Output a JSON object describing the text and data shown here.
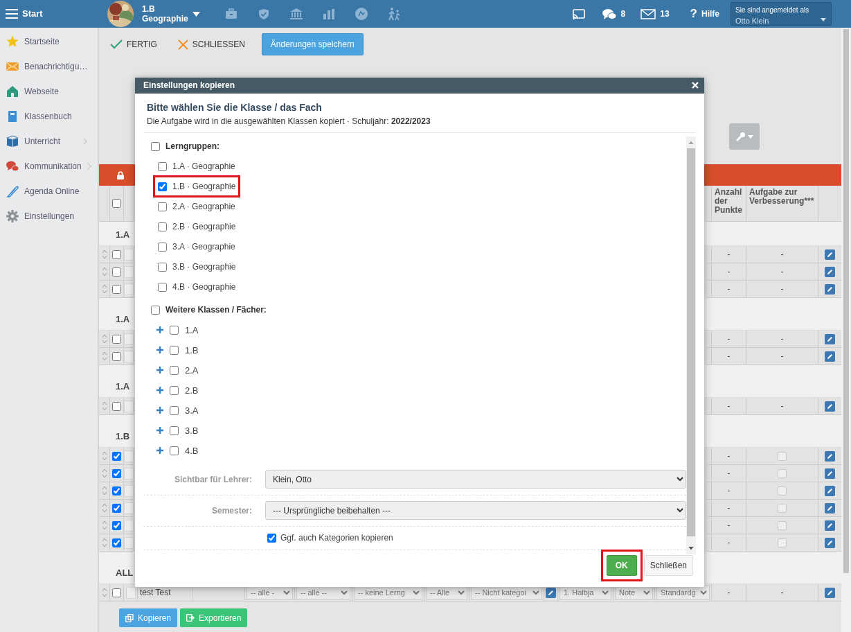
{
  "header": {
    "menu_label": "Start",
    "class_name": "1.B",
    "subject": "Geographie",
    "counters": [
      {
        "kind": "chat",
        "count": "8"
      },
      {
        "kind": "mail",
        "count": "13"
      }
    ],
    "help": {
      "icon": "?",
      "label": "Hilfe"
    },
    "login": {
      "label": "Sie sind angemeldet als",
      "user": "Otto Klein"
    }
  },
  "sidebar": {
    "items": [
      {
        "kind": "star",
        "label": "Startseite",
        "has_submenu": false
      },
      {
        "kind": "mail",
        "label": "Benachrichtigu…",
        "has_submenu": false
      },
      {
        "kind": "home",
        "label": "Webseite",
        "has_submenu": false
      },
      {
        "kind": "notebook",
        "label": "Klassenbuch",
        "has_submenu": false
      },
      {
        "kind": "book",
        "label": "Unterricht",
        "has_submenu": true
      },
      {
        "kind": "chat",
        "label": "Kommunikation",
        "has_submenu": true
      },
      {
        "kind": "pen",
        "label": "Agenda Online",
        "has_submenu": false
      },
      {
        "kind": "gear",
        "label": "Einstellungen",
        "has_submenu": false
      }
    ]
  },
  "toolbar": [
    {
      "kind": "check",
      "label": "FERTIG"
    },
    {
      "kind": "cross",
      "label": "SCHLIESSEN"
    },
    {
      "kind": "primary",
      "label": "Änderungen speichern"
    }
  ],
  "table": {
    "header_checked": false,
    "columns": [
      {
        "label": "Anzahl der Punkte"
      },
      {
        "label": "Aufgabe zur Verbesserung***"
      }
    ],
    "groups": [
      {
        "title": "1.A",
        "rows": [
          {
            "kind": "text",
            "checked": false,
            "points": "-",
            "correction": "-"
          },
          {
            "kind": "text",
            "checked": false,
            "points": "-",
            "correction": "-"
          },
          {
            "kind": "text",
            "checked": false,
            "points": "-",
            "correction": "-"
          }
        ]
      },
      {
        "title": "1.A",
        "rows": [
          {
            "kind": "text",
            "checked": false,
            "points": "-",
            "correction": "-"
          },
          {
            "kind": "text",
            "checked": false,
            "points": "-",
            "correction": "-"
          }
        ]
      },
      {
        "title": "1.A",
        "rows": [
          {
            "kind": "text",
            "checked": false,
            "points": "-",
            "correction": "-"
          }
        ]
      },
      {
        "title": "1.B",
        "rows": [
          {
            "kind": "checkbox",
            "checked": true,
            "points": "-",
            "correction_checked": false
          },
          {
            "kind": "checkbox",
            "checked": true,
            "points": "-",
            "correction_checked": false
          },
          {
            "kind": "checkbox",
            "checked": true,
            "points": "-",
            "correction_checked": false
          },
          {
            "kind": "checkbox",
            "checked": true,
            "points": "-",
            "correction_checked": false
          },
          {
            "kind": "checkbox",
            "checked": true,
            "points": "-",
            "correction_checked": false
          },
          {
            "kind": "checkbox",
            "checked": true,
            "points": "-",
            "correction_checked": false
          }
        ]
      },
      {
        "title": "ALL",
        "rows": [
          {
            "kind": "full",
            "checked": false,
            "name": "test Test",
            "selects": [
              "-- alle -",
              "-- alle --",
              "-- keine Lerng",
              "-- Alle",
              "-- Nicht kategoi"
            ],
            "semester": "1. Halbja",
            "type": "Note",
            "scheme": "Standardg",
            "points": "-",
            "correction": "-"
          }
        ]
      }
    ]
  },
  "footer_buttons": [
    {
      "kind": "copy",
      "label": "Kopieren"
    },
    {
      "kind": "export",
      "label": "Exportieren"
    }
  ],
  "modal": {
    "title": "Einstellungen kopieren",
    "heading": "Bitte wählen Sie die Klasse / das Fach",
    "subtitle": "Die Aufgabe wird in die ausgewählten Klassen kopiert · Schuljahr: **2022/2023**",
    "lerngruppen": {
      "label": "Lerngruppen:",
      "checked": false,
      "items": [
        {
          "label": "1.A · Geographie",
          "checked": false,
          "highlighted": false
        },
        {
          "label": "1.B · Geographie",
          "checked": true,
          "highlighted": true
        },
        {
          "label": "2.A · Geographie",
          "checked": false,
          "highlighted": false
        },
        {
          "label": "2.B · Geographie",
          "checked": false,
          "highlighted": false
        },
        {
          "label": "3.A · Geographie",
          "checked": false,
          "highlighted": false
        },
        {
          "label": "3.B · Geographie",
          "checked": false,
          "highlighted": false
        },
        {
          "label": "4.B · Geographie",
          "checked": false,
          "highlighted": false
        }
      ]
    },
    "weitere": {
      "label": "Weitere Klassen / Fächer:",
      "checked": false,
      "items": [
        {
          "label": "1.A",
          "checked": false,
          "expanded": false
        },
        {
          "label": "1.B",
          "checked": false,
          "expanded": false
        },
        {
          "label": "2.A",
          "checked": false,
          "expanded": false
        },
        {
          "label": "2.B",
          "checked": false,
          "expanded": false
        },
        {
          "label": "3.A",
          "checked": false,
          "expanded": false
        },
        {
          "label": "3.B",
          "checked": false,
          "expanded": false
        },
        {
          "label": "4.B",
          "checked": false,
          "expanded": false
        }
      ]
    },
    "fields": [
      {
        "label": "Sichtbar für Lehrer:",
        "value": "Klein, Otto"
      },
      {
        "label": "Semester:",
        "value": "--- Ursprüngliche beibehalten ---"
      }
    ],
    "option": {
      "label": "Ggf. auch Kategorien kopieren",
      "checked": true
    },
    "buttons": [
      {
        "kind": "success",
        "label": "OK",
        "highlighted": true
      },
      {
        "kind": "light",
        "label": "Schließen",
        "highlighted": false
      }
    ]
  }
}
